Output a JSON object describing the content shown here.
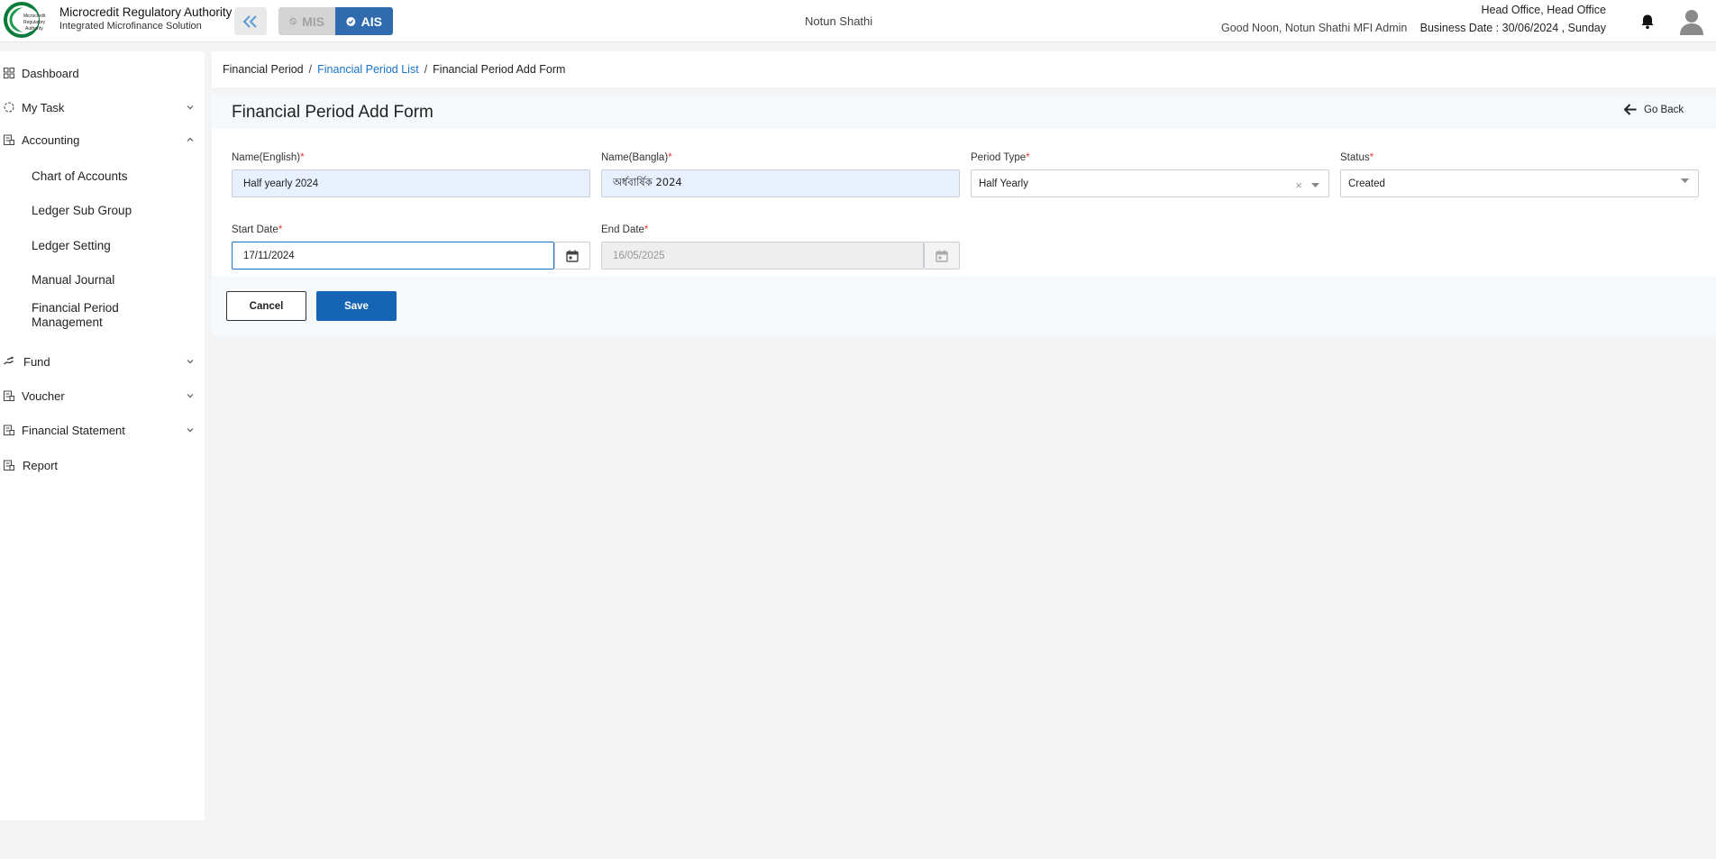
{
  "header": {
    "org_name": "Microcredit Regulatory Authority",
    "org_sub": "Integrated Microfinance Solution",
    "logo_text": "Microcredit Regulatory Authority",
    "mode_mis": "MIS",
    "mode_ais": "AIS",
    "center_title": "Notun Shathi",
    "greeting": "Good Noon, Notun Shathi MFI Admin",
    "office": "Head Office, Head Office",
    "business_date": "Business Date : 30/06/2024 , Sunday",
    "colors": {
      "accent": "#2f6bae",
      "link": "#1a73c8",
      "primary_button": "#1565b4",
      "required": "#e53935"
    }
  },
  "sidebar": {
    "items": [
      {
        "label": "Dashboard",
        "icon": "grid-icon"
      },
      {
        "label": "My Task",
        "icon": "task-icon"
      },
      {
        "label": "Accounting",
        "icon": "ledger-icon"
      },
      {
        "label": "Fund",
        "icon": "hand-money-icon"
      },
      {
        "label": "Voucher",
        "icon": "voucher-icon"
      },
      {
        "label": "Financial Statement",
        "icon": "statement-icon"
      },
      {
        "label": "Report",
        "icon": "report-icon"
      }
    ],
    "accounting_sub": [
      "Chart of Accounts",
      "Ledger Sub Group",
      "Ledger Setting",
      "Manual Journal",
      "Financial Period Management"
    ]
  },
  "breadcrumb": {
    "root": "Financial Period",
    "list": "Financial Period List",
    "current": "Financial Period Add Form"
  },
  "form": {
    "title": "Financial Period Add Form",
    "go_back": "Go Back",
    "name_en_label": "Name(English)",
    "name_en_value": "Half yearly 2024",
    "name_bn_label": "Name(Bangla)",
    "name_bn_value": "অর্ধবার্ষিক 2024",
    "period_type_label": "Period Type",
    "period_type_value": "Half Yearly",
    "status_label": "Status",
    "status_value": "Created",
    "start_date_label": "Start Date",
    "start_date_value": "17/11/2024",
    "end_date_label": "End Date",
    "end_date_value": "16/05/2025",
    "required_mark": "*",
    "cancel_label": "Cancel",
    "save_label": "Save"
  }
}
